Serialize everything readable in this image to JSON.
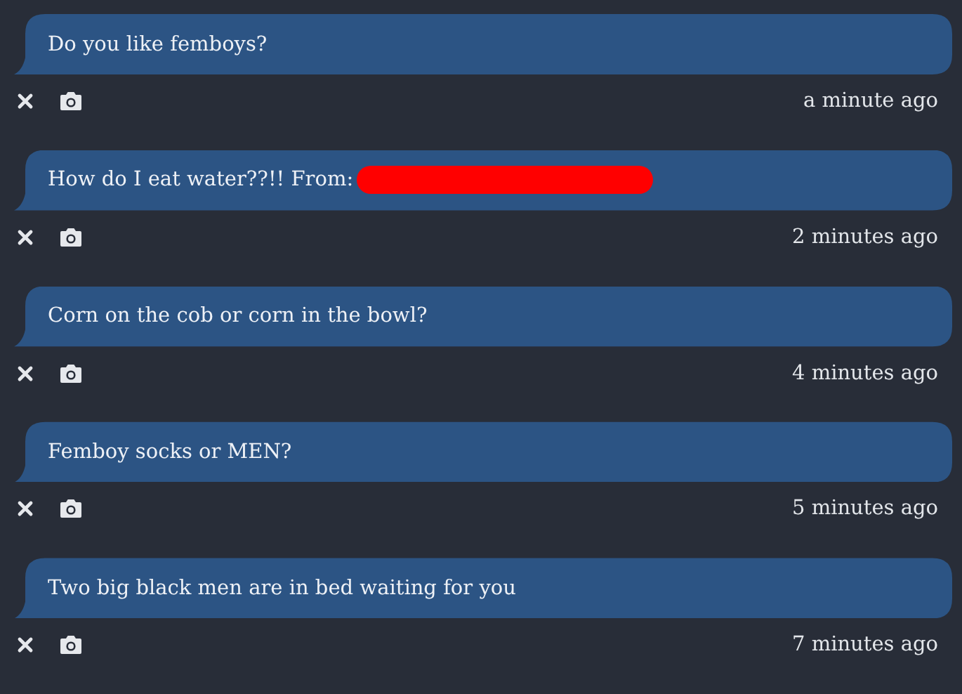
{
  "questions": [
    {
      "text": "Do you like femboys?",
      "redacted": false,
      "time": "a minute ago"
    },
    {
      "text": "How do I eat water??!! From:",
      "redacted": true,
      "time": "2 minutes ago"
    },
    {
      "text": "Corn on the cob or corn in the bowl?",
      "redacted": false,
      "time": "4 minutes ago"
    },
    {
      "text": "Femboy socks or MEN?",
      "redacted": false,
      "time": "5 minutes ago"
    },
    {
      "text": "Two big black men are in bed waiting for you",
      "redacted": false,
      "time": "7 minutes ago"
    }
  ]
}
